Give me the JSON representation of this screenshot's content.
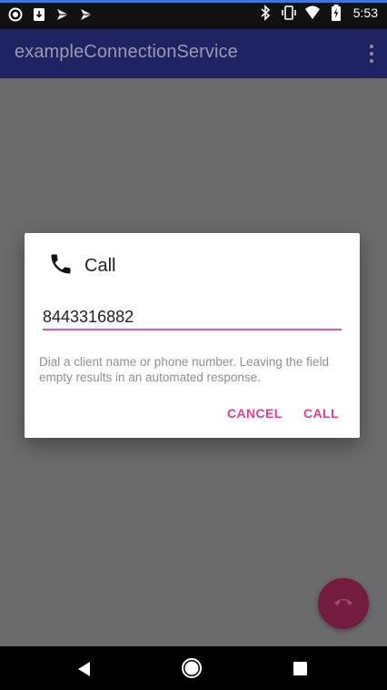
{
  "status_bar": {
    "time": "5:53",
    "left_icons": [
      "record-icon",
      "download-icon",
      "notification-icon",
      "notification-icon"
    ],
    "right_icons": [
      "bluetooth-icon",
      "vibrate-icon",
      "wifi-icon",
      "battery-charging-icon"
    ]
  },
  "app_bar": {
    "title": "exampleConnectionService",
    "menu_icon": "overflow-menu-icon"
  },
  "dialog": {
    "title": "Call",
    "icon": "phone-icon",
    "input_value": "8443316882",
    "hint": "Dial a client name or phone number. Leaving the field empty results in an automated response.",
    "cancel_label": "CANCEL",
    "call_label": "CALL"
  },
  "fab": {
    "icon": "end-call-icon"
  },
  "nav_bar": {
    "back": "back-icon",
    "home": "home-icon",
    "recents": "recents-icon"
  },
  "colors": {
    "app_bar": "#1f2362",
    "accent": "#e43f86",
    "scrim": "#6b6b6b",
    "fab": "#741c3e"
  }
}
